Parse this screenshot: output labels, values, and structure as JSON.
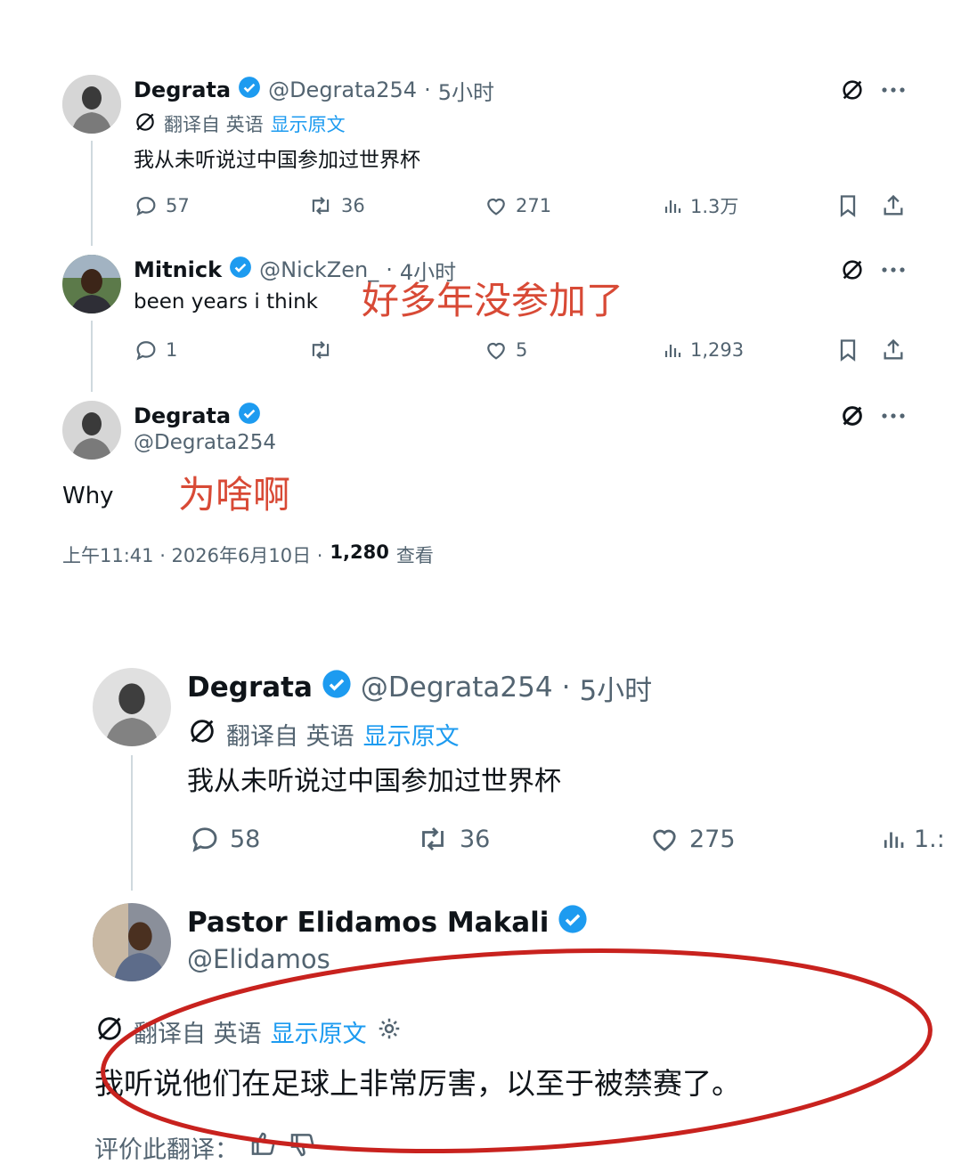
{
  "tweet1": {
    "name": "Degrata",
    "handle": "@Degrata254",
    "sep": "·",
    "time": "5小时",
    "translated_from": "翻译自 英语",
    "show_original": "显示原文",
    "text": "我从未听说过中国参加过世界杯",
    "replies": "57",
    "retweets": "36",
    "likes": "271",
    "views": "1.3万"
  },
  "tweet2": {
    "name": "Mitnick",
    "handle": "@NickZen_",
    "sep": "·",
    "time": "4小时",
    "text": "been years i think",
    "annotation": "好多年没参加了",
    "replies": "1",
    "likes": "5",
    "views": "1,293"
  },
  "tweet3": {
    "name": "Degrata",
    "handle": "@Degrata254",
    "text": "Why",
    "annotation": "为啥啊",
    "timestamp": "上午11:41 · 2026年6月10日 ·",
    "view_count": "1,280",
    "view_label": "查看"
  },
  "tweet4": {
    "name": "Degrata",
    "handle": "@Degrata254",
    "sep": "·",
    "time": "5小时",
    "translated_from": "翻译自 英语",
    "show_original": "显示原文",
    "text": "我从未听说过中国参加过世界杯",
    "replies": "58",
    "retweets": "36",
    "likes": "275",
    "views": "1.:"
  },
  "tweet5": {
    "name": "Pastor Elidamos Makali",
    "handle": "@Elidamos",
    "translated_from": "翻译自 英语",
    "show_original": "显示原文",
    "text": "我听说他们在足球上非常厉害，以至于被禁赛了。",
    "rate_translation": "评价此翻译："
  },
  "colors": {
    "accent": "#1d9bf0",
    "annotation_red": "#d84a36",
    "circle_red": "#c8221e",
    "text_gray": "#536471"
  }
}
